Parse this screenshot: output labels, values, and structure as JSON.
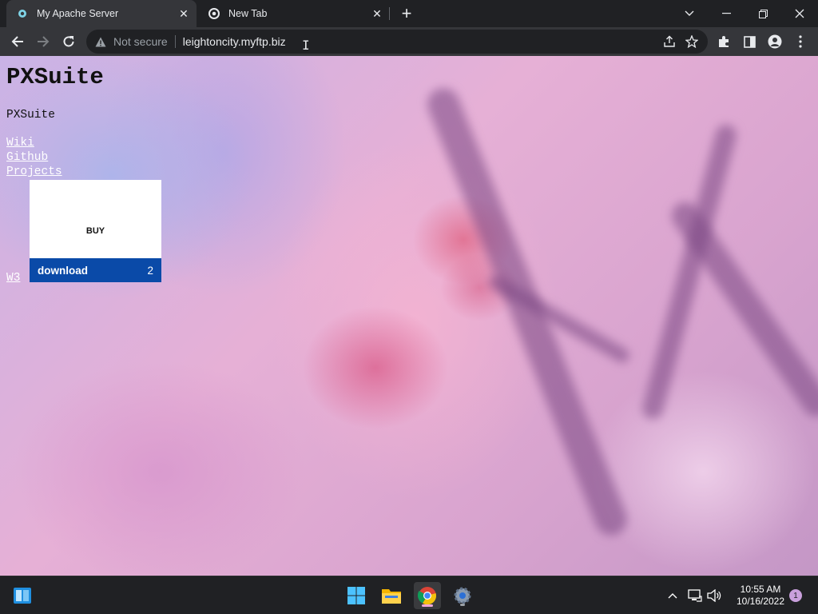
{
  "browser": {
    "tabs": [
      {
        "title": "My Apache Server",
        "active": true
      },
      {
        "title": "New Tab",
        "active": false
      }
    ],
    "address_bar": {
      "security_label": "Not secure",
      "url": "leightoncity.myftp.biz"
    }
  },
  "page": {
    "site_title": "PXSuite",
    "subtitle": "PXSuite",
    "nav_links": [
      "Wiki",
      "Github",
      "Projects"
    ],
    "footer_link": "W3",
    "buy_widget": {
      "buy_label": "BUY",
      "download_label": "download",
      "download_count": "2",
      "accent_color": "#0a4aa8"
    }
  },
  "taskbar": {
    "time": "10:55 AM",
    "date": "10/16/2022",
    "notification_count": "1"
  }
}
